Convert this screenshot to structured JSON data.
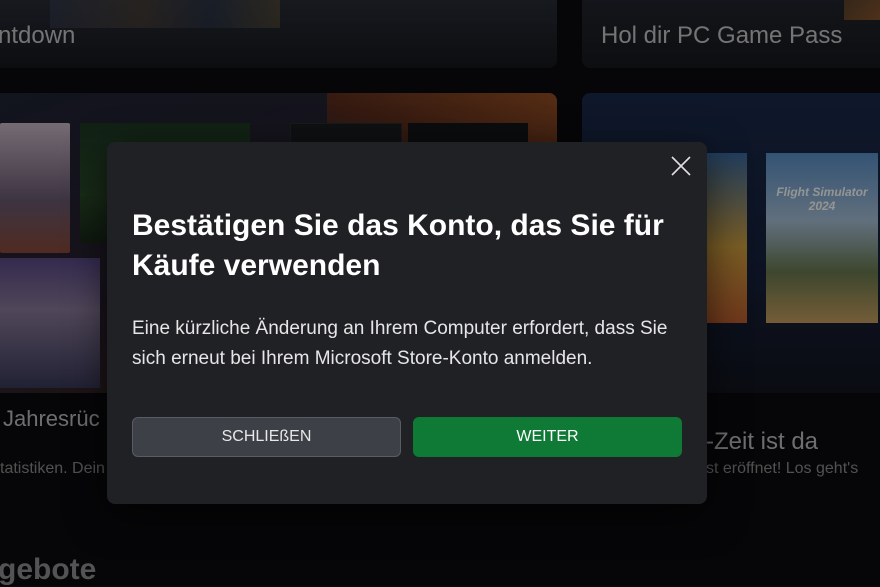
{
  "background": {
    "cards": {
      "countdown_title": "ntdown",
      "gamepass_title": "Hol dir PC Game Pass",
      "recap_title": "Jahresrüc",
      "recap_subtitle": "tatistiken. Dein",
      "zeit_title": "-Zeit ist da",
      "zeit_subtitle": "st eröffnet! Los geht's",
      "flight_title": "Flight Simulator 2024",
      "section_title": "gebote"
    }
  },
  "dialog": {
    "title": "Bestätigen Sie das Konto, das Sie für Käufe verwenden",
    "body": "Eine kürzliche Änderung an Ihrem Computer erfordert, dass Sie sich erneut bei Ihrem Microsoft Store-Konto anmelden.",
    "buttons": {
      "close_label": "SCHLIEßEN",
      "continue_label": "WEITER"
    },
    "close_icon": "close-icon"
  },
  "colors": {
    "dialog_background": "#202125",
    "primary_button": "#0e7a36",
    "secondary_button": "#3e4047"
  }
}
